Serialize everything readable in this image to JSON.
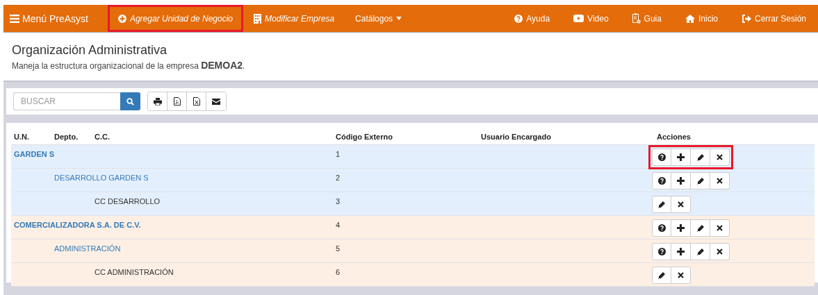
{
  "navbar": {
    "brand": {
      "label": "Menú PreAsyst",
      "kind": "menu"
    },
    "left_items": [
      {
        "label": "Agregar Unidad de Negocio",
        "kind": "add",
        "italic": true,
        "highlighted": true
      },
      {
        "label": "Modificar Empresa",
        "kind": "company",
        "italic": true,
        "highlighted": false
      },
      {
        "label": "Catálogos",
        "kind": "dropdown",
        "italic": false,
        "highlighted": false
      }
    ],
    "right_items": [
      {
        "label": "Ayuda",
        "kind": "help"
      },
      {
        "label": "Video",
        "kind": "video"
      },
      {
        "label": "Guia",
        "kind": "guide"
      },
      {
        "label": "Inicio",
        "kind": "home"
      },
      {
        "label": "Cerrar Sesión",
        "kind": "logout"
      }
    ]
  },
  "header": {
    "title": "Organización Administrativa",
    "subtitle": "Maneja la estructura organizacional de la empresa **DEMOA2**."
  },
  "toolbar": {
    "search": {
      "placeholder": "BUSCAR"
    },
    "export_buttons": [
      {
        "kind": "print"
      },
      {
        "kind": "pdf"
      },
      {
        "kind": "excel"
      },
      {
        "kind": "email"
      }
    ]
  },
  "table": {
    "columns": [
      "U.N.",
      "Depto.",
      "C.C.",
      "Código Externo",
      "Usuario Encargado",
      "Acciones"
    ],
    "rows": [
      {
        "name": "GARDEN S",
        "code": "1",
        "color": "#e4effd",
        "actions_highlighted": true,
        "actions": [
          {
            "kind": "help"
          },
          {
            "kind": "add"
          },
          {
            "kind": "edit"
          },
          {
            "kind": "delete"
          }
        ],
        "children": [
          {
            "name": "DESARROLLO GARDEN S",
            "code": "2",
            "actions_highlighted": false,
            "actions": [
              {
                "kind": "help"
              },
              {
                "kind": "add"
              },
              {
                "kind": "edit"
              },
              {
                "kind": "delete"
              }
            ],
            "children": [
              {
                "name": "CC DESARROLLO",
                "code": "3",
                "actions_highlighted": false,
                "actions": [
                  {
                    "kind": "edit"
                  },
                  {
                    "kind": "delete"
                  }
                ]
              }
            ]
          }
        ]
      },
      {
        "name": "COMERCIALIZADORA S.A. DE C.V.",
        "code": "4",
        "color": "#fdefe4",
        "actions_highlighted": false,
        "actions": [
          {
            "kind": "help"
          },
          {
            "kind": "add"
          },
          {
            "kind": "edit"
          },
          {
            "kind": "delete"
          }
        ],
        "children": [
          {
            "name": "ADMINISTRACIÓN",
            "code": "5",
            "actions_highlighted": false,
            "actions": [
              {
                "kind": "help"
              },
              {
                "kind": "add"
              },
              {
                "kind": "edit"
              },
              {
                "kind": "delete"
              }
            ],
            "children": [
              {
                "name": "CC ADMINISTRACIÓN",
                "code": "6",
                "actions_highlighted": false,
                "actions": [
                  {
                    "kind": "edit"
                  },
                  {
                    "kind": "delete"
                  }
                ]
              }
            ]
          }
        ]
      }
    ]
  }
}
